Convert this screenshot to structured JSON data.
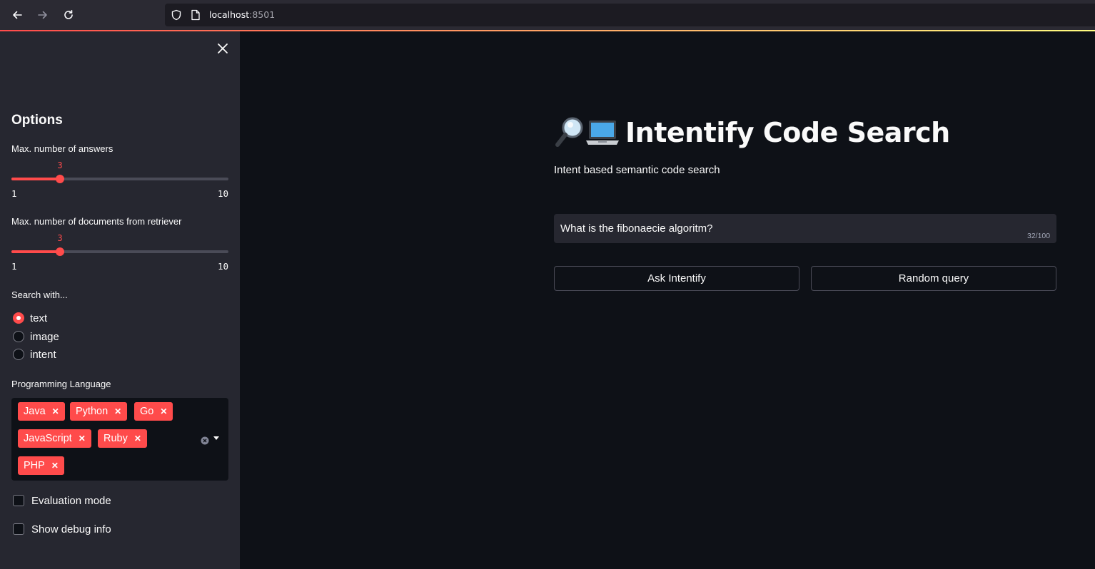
{
  "browser": {
    "url_host": "localhost",
    "url_port": ":8501",
    "icons": [
      "back-arrow-icon",
      "forward-arrow-icon",
      "reload-icon",
      "shield-icon",
      "page-icon"
    ]
  },
  "sidebar": {
    "title": "Options",
    "answers_slider": {
      "label": "Max. number of answers",
      "value": "3",
      "min": "1",
      "max": "10",
      "fraction": 0.2222
    },
    "docs_slider": {
      "label": "Max. number of documents from retriever",
      "value": "3",
      "min": "1",
      "max": "10",
      "fraction": 0.2222
    },
    "search_with": {
      "label": "Search with...",
      "options": [
        {
          "label": "text",
          "selected": true
        },
        {
          "label": "image",
          "selected": false
        },
        {
          "label": "intent",
          "selected": false
        }
      ]
    },
    "programming_language": {
      "label": "Programming Language",
      "tags": [
        "Java",
        "Python",
        "Go",
        "JavaScript",
        "Ruby",
        "PHP"
      ]
    },
    "evaluation_mode": {
      "label": "Evaluation mode",
      "checked": false
    },
    "debug_info": {
      "label": "Show debug info",
      "checked": false
    }
  },
  "main": {
    "title": "Intentify Code Search",
    "subtitle": "Intent based semantic code search",
    "query": {
      "value": "What is the fibonaecie algoritm?",
      "counter": "32/100"
    },
    "ask_button": "Ask Intentify",
    "random_button": "Random query"
  },
  "colors": {
    "accent": "#ff4b4b",
    "background": "#0e1117",
    "sidebar": "#262730"
  }
}
